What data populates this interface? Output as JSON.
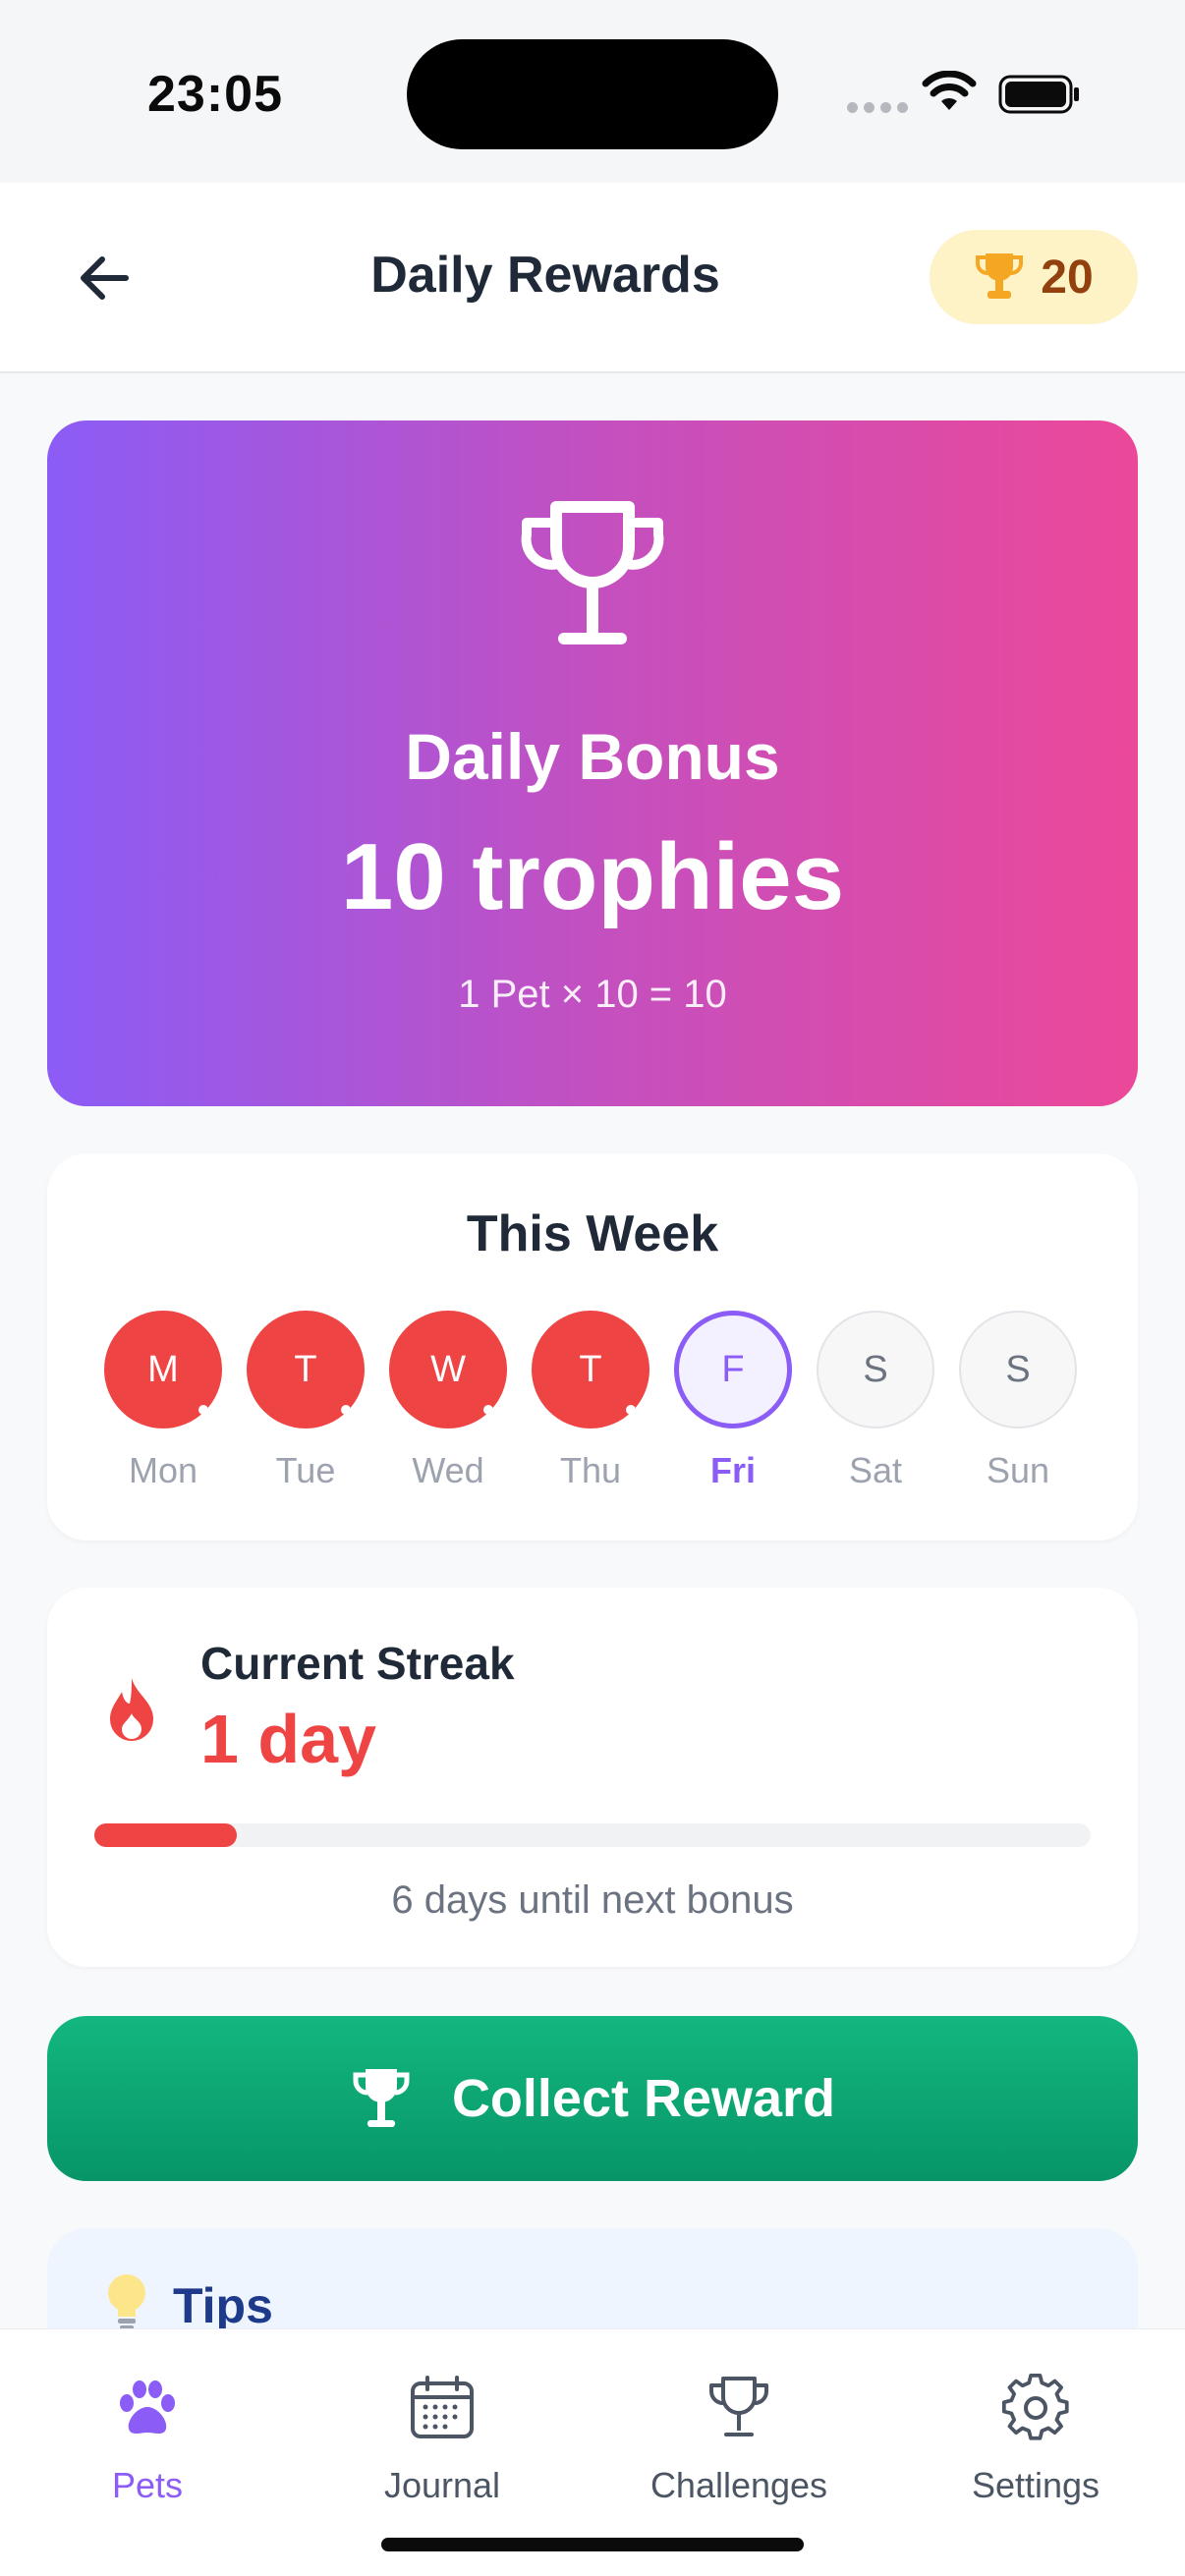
{
  "status_bar": {
    "time": "23:05"
  },
  "header": {
    "title": "Daily Rewards",
    "trophy_count": "20"
  },
  "hero": {
    "title": "Daily Bonus",
    "amount": "10 trophies",
    "formula": "1 Pet × 10 = 10"
  },
  "week": {
    "title": "This Week",
    "days": [
      {
        "letter": "M",
        "label": "Mon",
        "state": "done"
      },
      {
        "letter": "T",
        "label": "Tue",
        "state": "done"
      },
      {
        "letter": "W",
        "label": "Wed",
        "state": "done"
      },
      {
        "letter": "T",
        "label": "Thu",
        "state": "done"
      },
      {
        "letter": "F",
        "label": "Fri",
        "state": "today"
      },
      {
        "letter": "S",
        "label": "Sat",
        "state": "future"
      },
      {
        "letter": "S",
        "label": "Sun",
        "state": "future"
      }
    ]
  },
  "streak": {
    "label": "Current Streak",
    "value": "1 day",
    "progress": 0.143,
    "next_text": "6 days until next bonus"
  },
  "collect_button": {
    "label": "Collect Reward"
  },
  "tips": {
    "title": "Tips"
  },
  "tab_bar": {
    "tabs": [
      {
        "label": "Pets",
        "icon": "paw-icon",
        "active": true
      },
      {
        "label": "Journal",
        "icon": "calendar-icon",
        "active": false
      },
      {
        "label": "Challenges",
        "icon": "trophy-icon",
        "active": false
      },
      {
        "label": "Settings",
        "icon": "gear-icon",
        "active": false
      }
    ]
  },
  "colors": {
    "accent": "#8B5CF6",
    "streak_red": "#EF4444",
    "collect_green": "#10B981",
    "gradient_start": "#8B5CF6",
    "gradient_end": "#EC4899"
  }
}
